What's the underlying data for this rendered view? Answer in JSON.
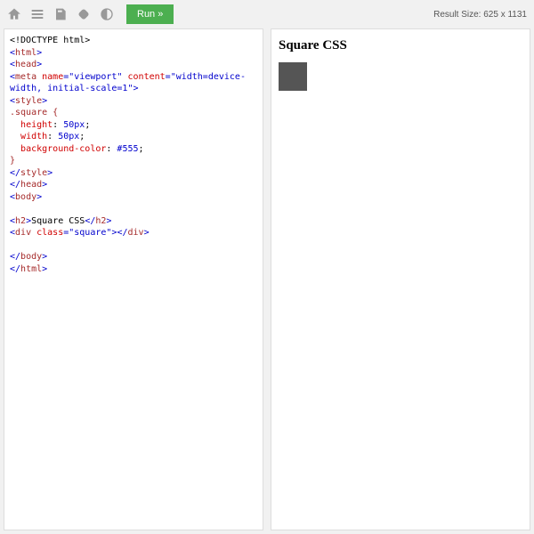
{
  "toolbar": {
    "run_label": "Run »"
  },
  "result_size": {
    "label": "Result Size:",
    "width": "625",
    "sep": "x",
    "height": "1131"
  },
  "code": {
    "l1": "<!DOCTYPE html>",
    "l2_open": "<",
    "l2_tag": "html",
    "l2_close": ">",
    "l3_open": "<",
    "l3_tag": "head",
    "l3_close": ">",
    "l4_open": "<",
    "l4_tag": "meta",
    "l4_attr_name": " name",
    "l4_eq1": "=",
    "l4_val1": "\"viewport\"",
    "l4_attr_content": " content",
    "l4_eq2": "=",
    "l4_val2": "\"width=device-width, initial-scale=1\"",
    "l4_close": ">",
    "l5_open": "<",
    "l5_tag": "style",
    "l5_close": ">",
    "l6_sel": ".square {",
    "l7_prop": "  height",
    "l7_colon": ": ",
    "l7_val": "50px",
    "l7_semi": ";",
    "l8_prop": "  width",
    "l8_colon": ": ",
    "l8_val": "50px",
    "l8_semi": ";",
    "l9_prop": "  background-color",
    "l9_colon": ": ",
    "l9_val": "#555",
    "l9_semi": ";",
    "l10_brace": "}",
    "l11_open": "</",
    "l11_tag": "style",
    "l11_close": ">",
    "l12_open": "</",
    "l12_tag": "head",
    "l12_close": ">",
    "l13_open": "<",
    "l13_tag": "body",
    "l13_close": ">",
    "l15_open": "<",
    "l15_tag": "h2",
    "l15_close": ">",
    "l15_text": "Square CSS",
    "l15_open2": "</",
    "l15_tag2": "h2",
    "l15_close2": ">",
    "l16_open": "<",
    "l16_tag": "div",
    "l16_attr": " class",
    "l16_eq": "=",
    "l16_val": "\"square\"",
    "l16_close": ">",
    "l16_open2": "</",
    "l16_tag2": "div",
    "l16_close2": ">",
    "l18_open": "</",
    "l18_tag": "body",
    "l18_close": ">",
    "l19_open": "</",
    "l19_tag": "html",
    "l19_close": ">"
  },
  "output": {
    "heading": "Square CSS"
  }
}
